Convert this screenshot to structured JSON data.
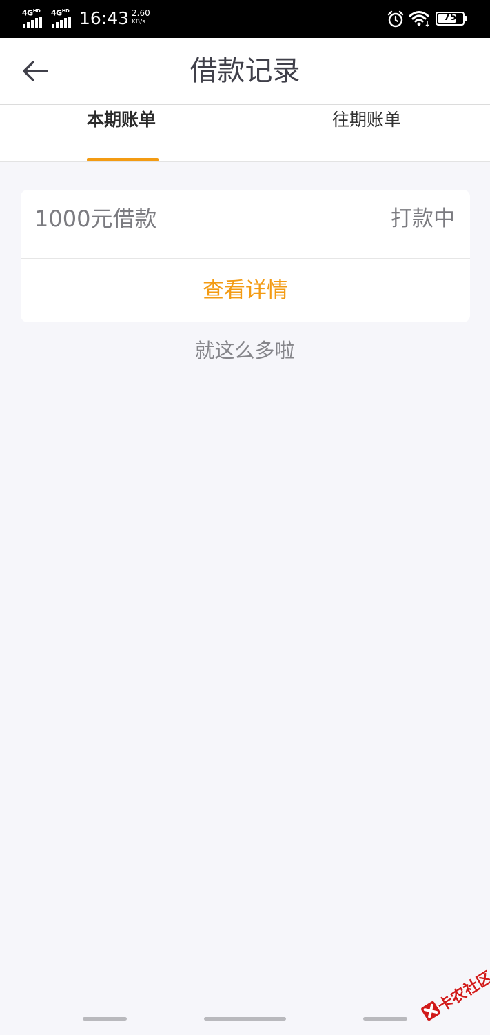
{
  "status_bar": {
    "network_1": "4G",
    "network_1_sup": "HD",
    "network_2": "4G",
    "network_2_sup": "HD",
    "time": "16:43",
    "speed_value": "2.60",
    "speed_unit": "KB/s",
    "battery_level": "75",
    "battery_fraction": 0.75,
    "icons": [
      "signal-icon",
      "signal-icon",
      "alarm-icon",
      "wifi-icon",
      "battery-icon"
    ]
  },
  "nav": {
    "back_icon": "arrow-left-icon",
    "title": "借款记录"
  },
  "tabs": [
    {
      "label": "本期账单",
      "active": true
    },
    {
      "label": "往期账单",
      "active": false
    }
  ],
  "loan_card": {
    "amount_label": "1000元借款",
    "status": "打款中",
    "detail_button": "查看详情"
  },
  "list_end_text": "就这么多啦",
  "watermark": {
    "text": "卡农社区",
    "icon": "kanong-logo-icon"
  },
  "colors": {
    "accent": "#f39b13",
    "background": "#f6f6fa",
    "title_text": "#40404a",
    "muted_text": "#7b7b80"
  }
}
